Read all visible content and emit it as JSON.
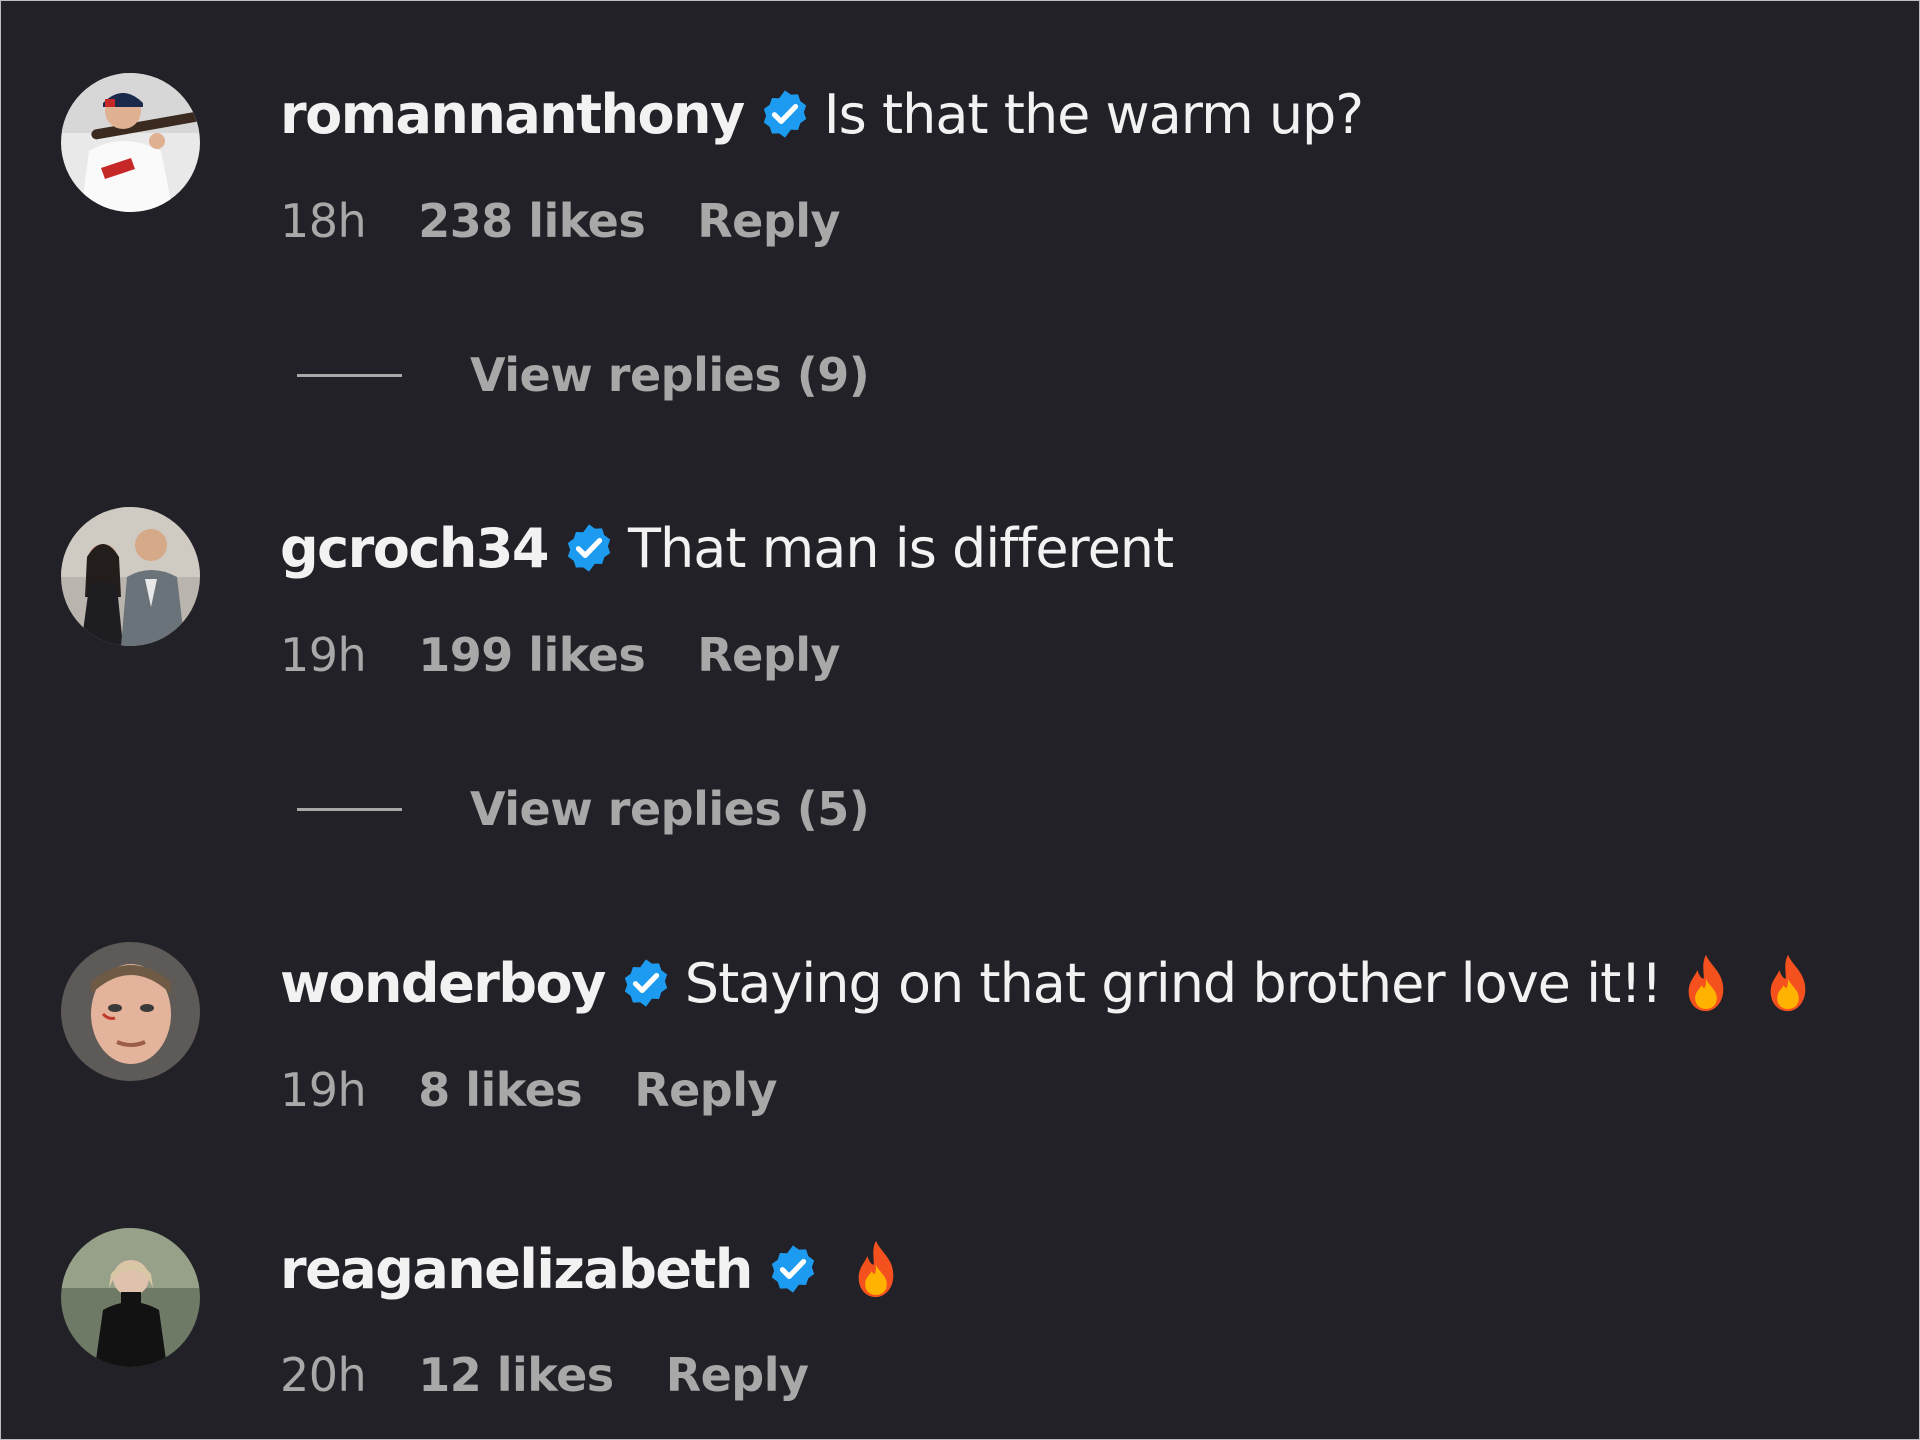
{
  "colors": {
    "background": "#212127",
    "primary_text": "#f2f2f2",
    "secondary_text": "#a8a8a8",
    "verified_badge": "#1d9bf0",
    "fire_outer": "#f4511e",
    "fire_inner": "#ffb300"
  },
  "comments": [
    {
      "username": "romannanthony",
      "verified": true,
      "text": "Is that the warm up?",
      "emojis": [],
      "time": "18h",
      "likes": "238 likes",
      "reply_label": "Reply",
      "view_replies": "View replies (9)",
      "avatar_icon": "baseball-player-avatar"
    },
    {
      "username": "gcroch34",
      "verified": true,
      "text": "That man is different",
      "emojis": [],
      "time": "19h",
      "likes": "199 likes",
      "reply_label": "Reply",
      "view_replies": "View replies (5)",
      "avatar_icon": "couple-photo-avatar"
    },
    {
      "username": "wonderboy",
      "verified": true,
      "text": "Staying on that grind brother love it!!",
      "emojis": [
        "fire-icon",
        "fire-icon"
      ],
      "time": "19h",
      "likes": "8 likes",
      "reply_label": "Reply",
      "view_replies": null,
      "avatar_icon": "fighter-face-avatar"
    },
    {
      "username": "reaganelizabeth",
      "verified": true,
      "text": "",
      "emojis": [
        "fire-icon"
      ],
      "time": "20h",
      "likes": "12 likes",
      "reply_label": "Reply",
      "view_replies": null,
      "avatar_icon": "woman-portrait-avatar"
    }
  ]
}
